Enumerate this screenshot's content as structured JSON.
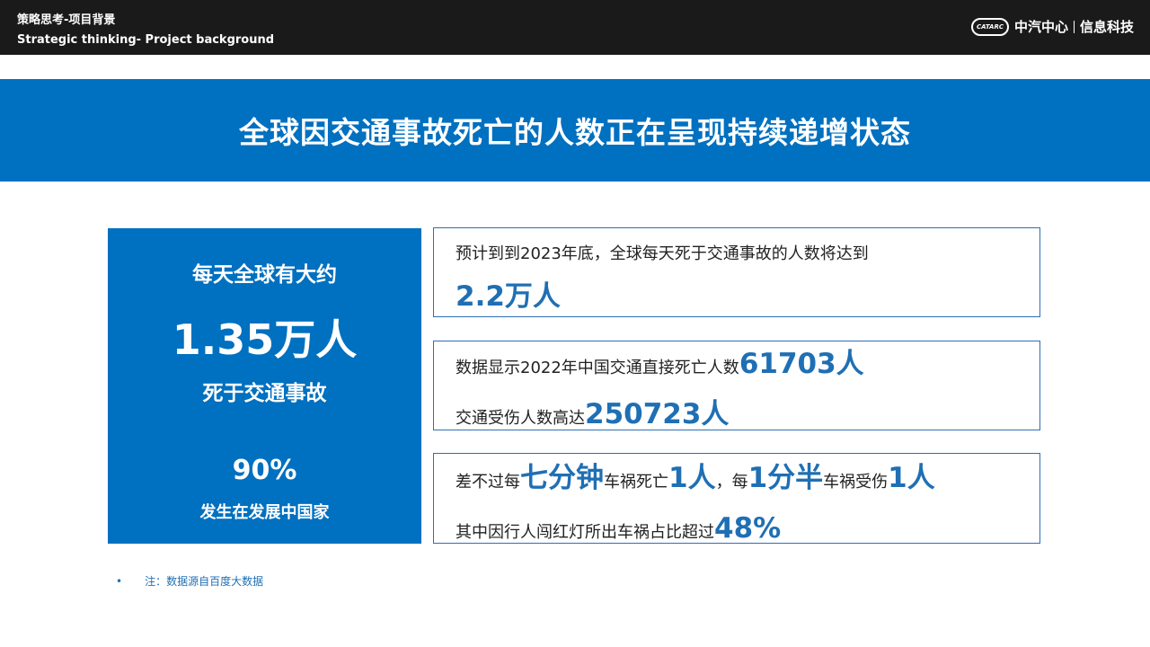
{
  "header": {
    "title_cn": "策略思考-项目背景",
    "title_en": "Strategic thinking- Project background",
    "logo_emblem": "CATARC",
    "logo_org": "中汽中心",
    "logo_unit": "信息科技"
  },
  "banner": {
    "title": "全球因交通事故死亡的人数正在呈现持续递增状态"
  },
  "left_panel": {
    "line1": "每天全球有大约",
    "line2": "1.35万人",
    "line3": "死于交通事故",
    "line4": "90%",
    "line5": "发生在发展中国家"
  },
  "cards": [
    {
      "text1": "预计到到2023年底，全球每天死于交通事故的人数将达到",
      "value1": "2.2万人"
    },
    {
      "text1": "数据显示2022年中国交通直接死亡人数",
      "value1": "61703人",
      "text2": "交通受伤人数高达",
      "value2": "250723人"
    },
    {
      "t1": "差不过每",
      "v1": "七分钟",
      "t2": "车祸死亡",
      "v2": "1人",
      "t3": "，每",
      "v3": "1分半",
      "t4": "车祸受伤",
      "v4": "1人",
      "t5": "其中因行人闯红灯所出车祸占比超过",
      "v5": "48%"
    }
  ],
  "note": {
    "bullet": "•",
    "text": "注：数据源自百度大数据"
  }
}
